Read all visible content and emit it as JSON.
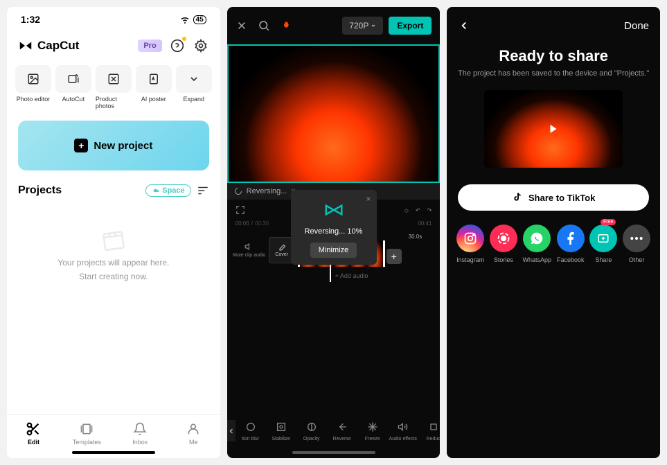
{
  "s1": {
    "status_time": "1:32",
    "battery": "45",
    "app_name": "CapCut",
    "pro": "Pro",
    "tools": [
      {
        "label": "Photo editor"
      },
      {
        "label": "AutoCut"
      },
      {
        "label": "Product photos"
      },
      {
        "label": "AI poster"
      },
      {
        "label": "Expand"
      }
    ],
    "new_project": "New project",
    "projects_heading": "Projects",
    "space": "Space",
    "empty_line1": "Your projects will appear here.",
    "empty_line2": "Start creating now.",
    "tabs": [
      {
        "label": "Edit"
      },
      {
        "label": "Templates"
      },
      {
        "label": "Inbox"
      },
      {
        "label": "Me"
      }
    ]
  },
  "s2": {
    "resolution": "720P",
    "export": "Export",
    "clip_status": "Reversing...",
    "dialog_text": "Reversing... 10%",
    "minimize": "Minimize",
    "time_current": "00:00",
    "time_total": "00:30",
    "time_end": "00:41",
    "mute_label": "Mute clip audio",
    "cover_label": "Cover",
    "clip_duration": "30.0s",
    "add_audio": "+ Add audio",
    "tools": [
      "tion blur",
      "Stabilize",
      "Opacity",
      "Reverse",
      "Freeze",
      "Audio effects",
      "Reduc"
    ]
  },
  "s3": {
    "done": "Done",
    "title": "Ready to share",
    "subtitle": "The project has been saved to the device and \"Projects.\"",
    "tiktok": "Share to TikTok",
    "free": "Free",
    "shares": [
      {
        "label": "Instagram"
      },
      {
        "label": "Stories"
      },
      {
        "label": "WhatsApp"
      },
      {
        "label": "Facebook"
      },
      {
        "label": "Share"
      },
      {
        "label": "Other"
      }
    ]
  }
}
